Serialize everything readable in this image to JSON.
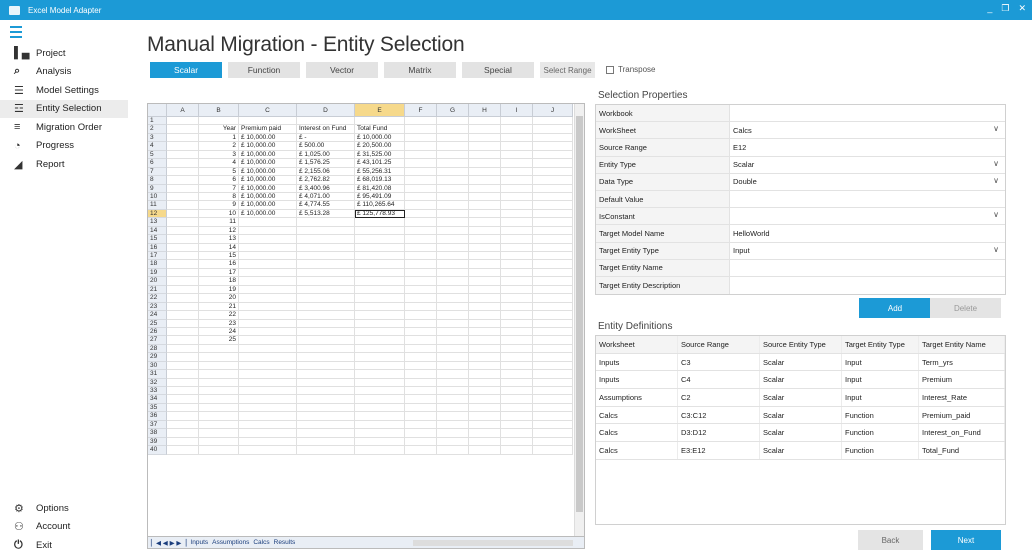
{
  "window": {
    "title": "Excel Model Adapter",
    "controls": [
      "_",
      "❐",
      "✕"
    ]
  },
  "nav": {
    "items": [
      {
        "label": "Project",
        "icon": "project-icon",
        "glyph": "▌▄"
      },
      {
        "label": "Analysis",
        "icon": "search-icon",
        "glyph": "⌕"
      },
      {
        "label": "Model Settings",
        "icon": "settings-list-icon",
        "glyph": "☰"
      },
      {
        "label": "Entity Selection",
        "icon": "selection-list-icon",
        "glyph": "☲"
      },
      {
        "label": "Migration Order",
        "icon": "order-icon",
        "glyph": "≡"
      },
      {
        "label": "Progress",
        "icon": "progress-icon",
        "glyph": "◔"
      },
      {
        "label": "Report",
        "icon": "report-icon",
        "glyph": "◢"
      }
    ],
    "active_index": 3,
    "bottom": [
      {
        "label": "Options",
        "icon": "gear-icon",
        "glyph": "⚙"
      },
      {
        "label": "Account",
        "icon": "user-icon",
        "glyph": "⚇"
      },
      {
        "label": "Exit",
        "icon": "power-icon",
        "glyph": "⏻"
      }
    ]
  },
  "page": {
    "title": "Manual Migration - Entity Selection"
  },
  "tabs": [
    "Scalar",
    "Function",
    "Vector",
    "Matrix",
    "Special"
  ],
  "active_tab": "Scalar",
  "select_range_label": "Select Range",
  "transpose_label": "Transpose",
  "spreadsheet": {
    "columns": [
      "A",
      "B",
      "C",
      "D",
      "E",
      "F",
      "G",
      "H",
      "I",
      "J"
    ],
    "selected_column": "E",
    "selected_row": 12,
    "rows": [
      [
        "",
        "",
        "",
        "",
        "",
        "",
        "",
        "",
        "",
        ""
      ],
      [
        "",
        "Year",
        "Premium paid",
        "Interest on Fund",
        "Total Fund",
        "",
        "",
        "",
        "",
        ""
      ],
      [
        "",
        "1",
        "£      10,000.00",
        "£              -",
        "£  10,000.00",
        "",
        "",
        "",
        "",
        ""
      ],
      [
        "",
        "2",
        "£      10,000.00",
        "£       500.00",
        "£  20,500.00",
        "",
        "",
        "",
        "",
        ""
      ],
      [
        "",
        "3",
        "£      10,000.00",
        "£     1,025.00",
        "£  31,525.00",
        "",
        "",
        "",
        "",
        ""
      ],
      [
        "",
        "4",
        "£      10,000.00",
        "£     1,576.25",
        "£  43,101.25",
        "",
        "",
        "",
        "",
        ""
      ],
      [
        "",
        "5",
        "£      10,000.00",
        "£     2,155.06",
        "£  55,256.31",
        "",
        "",
        "",
        "",
        ""
      ],
      [
        "",
        "6",
        "£      10,000.00",
        "£     2,762.82",
        "£  68,019.13",
        "",
        "",
        "",
        "",
        ""
      ],
      [
        "",
        "7",
        "£      10,000.00",
        "£     3,400.96",
        "£  81,420.08",
        "",
        "",
        "",
        "",
        ""
      ],
      [
        "",
        "8",
        "£      10,000.00",
        "£     4,071.00",
        "£  95,491.09",
        "",
        "",
        "",
        "",
        ""
      ],
      [
        "",
        "9",
        "£      10,000.00",
        "£     4,774.55",
        "£ 110,265.64",
        "",
        "",
        "",
        "",
        ""
      ],
      [
        "",
        "10",
        "£      10,000.00",
        "£     5,513.28",
        "£ 125,778.93",
        "",
        "",
        "",
        "",
        ""
      ],
      [
        "",
        "11",
        "",
        "",
        "",
        "",
        "",
        "",
        "",
        ""
      ],
      [
        "",
        "12",
        "",
        "",
        "",
        "",
        "",
        "",
        "",
        ""
      ],
      [
        "",
        "13",
        "",
        "",
        "",
        "",
        "",
        "",
        "",
        ""
      ],
      [
        "",
        "14",
        "",
        "",
        "",
        "",
        "",
        "",
        "",
        ""
      ],
      [
        "",
        "15",
        "",
        "",
        "",
        "",
        "",
        "",
        "",
        ""
      ],
      [
        "",
        "16",
        "",
        "",
        "",
        "",
        "",
        "",
        "",
        ""
      ],
      [
        "",
        "17",
        "",
        "",
        "",
        "",
        "",
        "",
        "",
        ""
      ],
      [
        "",
        "18",
        "",
        "",
        "",
        "",
        "",
        "",
        "",
        ""
      ],
      [
        "",
        "19",
        "",
        "",
        "",
        "",
        "",
        "",
        "",
        ""
      ],
      [
        "",
        "20",
        "",
        "",
        "",
        "",
        "",
        "",
        "",
        ""
      ],
      [
        "",
        "21",
        "",
        "",
        "",
        "",
        "",
        "",
        "",
        ""
      ],
      [
        "",
        "22",
        "",
        "",
        "",
        "",
        "",
        "",
        "",
        ""
      ],
      [
        "",
        "23",
        "",
        "",
        "",
        "",
        "",
        "",
        "",
        ""
      ],
      [
        "",
        "24",
        "",
        "",
        "",
        "",
        "",
        "",
        "",
        ""
      ],
      [
        "",
        "25",
        "",
        "",
        "",
        "",
        "",
        "",
        "",
        ""
      ]
    ],
    "total_rows": 40,
    "sheet_tabs": [
      "Inputs",
      "Assumptions",
      "Calcs",
      "Results"
    ]
  },
  "selection_properties": {
    "title": "Selection Properties",
    "rows": [
      {
        "label": "Workbook",
        "value": "",
        "dropdown": false
      },
      {
        "label": "WorkSheet",
        "value": "Calcs",
        "dropdown": true
      },
      {
        "label": "Source Range",
        "value": "E12",
        "dropdown": false
      },
      {
        "label": "Entity Type",
        "value": "Scalar",
        "dropdown": true
      },
      {
        "label": "Data Type",
        "value": "Double",
        "dropdown": true
      },
      {
        "label": "Default Value",
        "value": "",
        "dropdown": false
      },
      {
        "label": "IsConstant",
        "value": "",
        "dropdown": true
      },
      {
        "label": "Target Model Name",
        "value": "HelloWorld",
        "dropdown": false
      },
      {
        "label": "Target Entity Type",
        "value": "Input",
        "dropdown": true
      },
      {
        "label": "Target Entity Name",
        "value": "",
        "dropdown": false
      },
      {
        "label": "Target Entity Description",
        "value": "",
        "dropdown": false
      }
    ],
    "add_label": "Add",
    "delete_label": "Delete"
  },
  "entity_definitions": {
    "title": "Entity Definitions",
    "columns": [
      "Worksheet",
      "Source Range",
      "Source Entity Type",
      "Target Entity Type",
      "Target Entity Name"
    ],
    "rows": [
      [
        "Inputs",
        "C3",
        "Scalar",
        "Input",
        "Term_yrs"
      ],
      [
        "Inputs",
        "C4",
        "Scalar",
        "Input",
        "Premium"
      ],
      [
        "Assumptions",
        "C2",
        "Scalar",
        "Input",
        "Interest_Rate"
      ],
      [
        "Calcs",
        "C3:C12",
        "Scalar",
        "Function",
        "Premium_paid"
      ],
      [
        "Calcs",
        "D3:D12",
        "Scalar",
        "Function",
        "Interest_on_Fund"
      ],
      [
        "Calcs",
        "E3:E12",
        "Scalar",
        "Function",
        "Total_Fund"
      ]
    ]
  },
  "footer": {
    "back_label": "Back",
    "next_label": "Next"
  }
}
